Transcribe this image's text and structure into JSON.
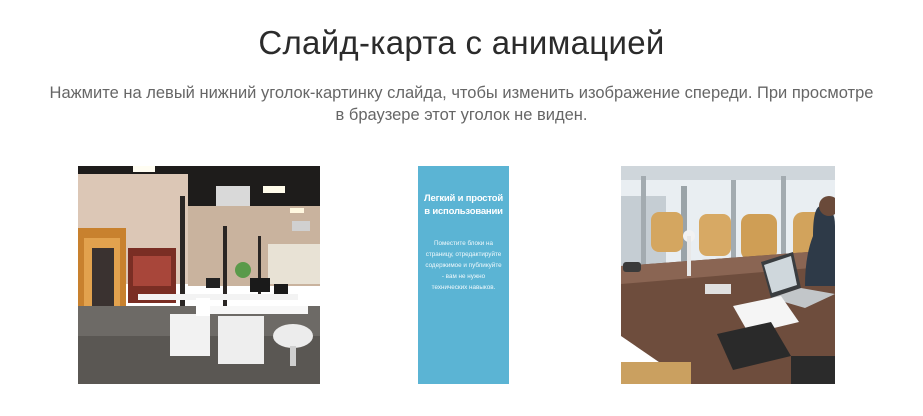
{
  "header": {
    "title": "Слайд-карта с анимацией",
    "subtitle": "Нажмите на левый нижний уголок-картинку слайда, чтобы изменить изображение спереди. При просмотре в браузере этот уголок не виден."
  },
  "cards": {
    "middle": {
      "heading": "Легкий и простой в использовании",
      "text": "Поместите блоки на страницу, отредактируйте содержимое и публикуйте - вам не нужно технических навыков."
    }
  },
  "colors": {
    "card_middle_bg": "#5bb4d4",
    "title": "#2b2b2b",
    "subtitle": "#666666"
  }
}
